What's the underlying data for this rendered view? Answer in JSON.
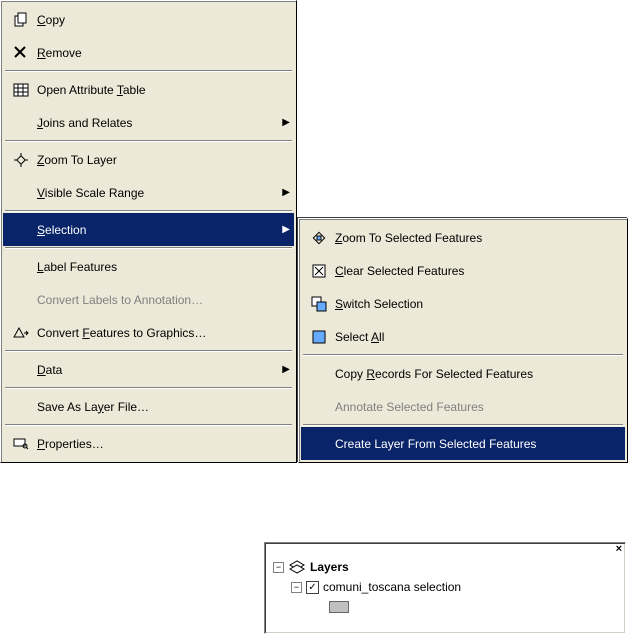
{
  "primary_menu": {
    "copy": "Copy",
    "remove": "Remove",
    "open_attr_table": "Open Attribute Table",
    "joins_relates": "Joins and Relates",
    "zoom_to_layer": "Zoom To Layer",
    "visible_scale_range": "Visible Scale Range",
    "selection": "Selection",
    "label_features": "Label Features",
    "convert_labels": "Convert Labels to Annotation…",
    "convert_features": "Convert Features to Graphics…",
    "data": "Data",
    "save_as_layer_file": "Save As Layer File…",
    "properties": "Properties…"
  },
  "selection_submenu": {
    "zoom_selected": "Zoom To Selected Features",
    "clear_selected": "Clear Selected Features",
    "switch_selection": "Switch Selection",
    "select_all": "Select All",
    "copy_records": "Copy Records For Selected Features",
    "annotate_selected": "Annotate Selected Features",
    "create_layer": "Create Layer From Selected Features"
  },
  "toc": {
    "root_label": "Layers",
    "layer_name": "comuni_toscana selection"
  }
}
